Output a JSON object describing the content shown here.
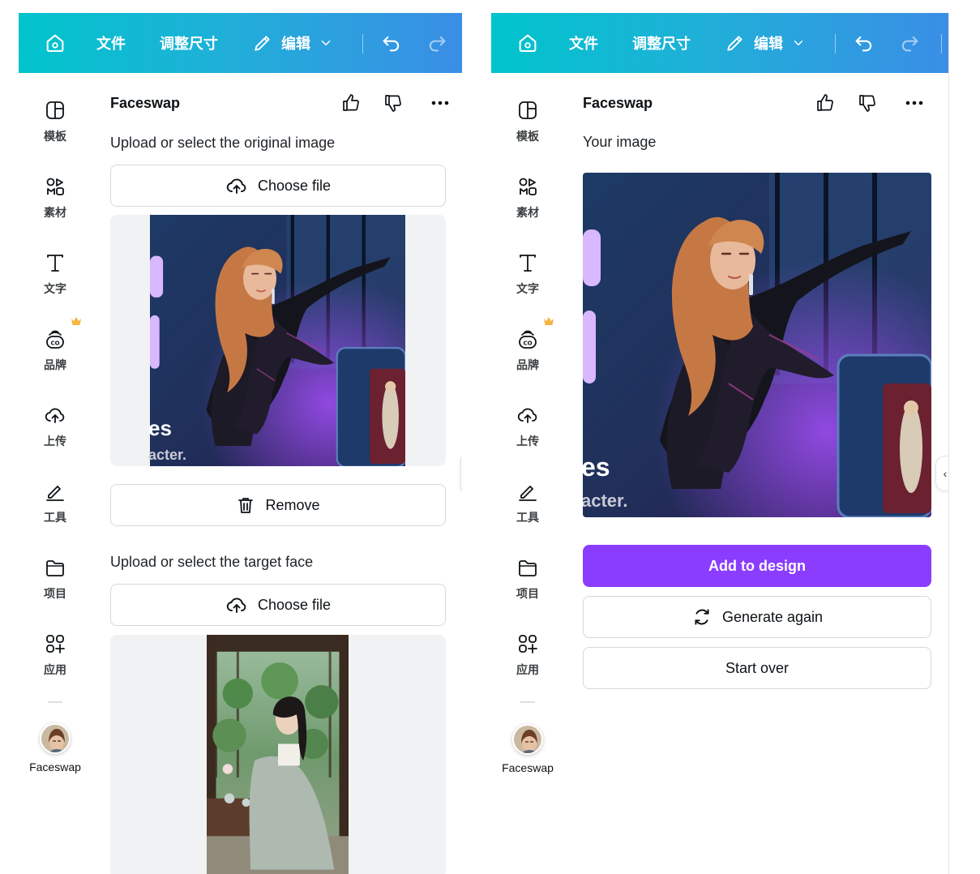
{
  "topbar": {
    "file": "文件",
    "resize": "调整尺寸",
    "edit": "编辑"
  },
  "sidebar": {
    "items": [
      {
        "label": "模板",
        "icon": "template-icon"
      },
      {
        "label": "素材",
        "icon": "elements-icon"
      },
      {
        "label": "文字",
        "icon": "text-icon"
      },
      {
        "label": "品牌",
        "icon": "brand-icon"
      },
      {
        "label": "上传",
        "icon": "upload-icon"
      },
      {
        "label": "工具",
        "icon": "tools-icon"
      },
      {
        "label": "项目",
        "icon": "projects-icon"
      },
      {
        "label": "应用",
        "icon": "apps-icon"
      }
    ],
    "active_app": "Faceswap"
  },
  "left_panel": {
    "title": "Faceswap",
    "original_label": "Upload or select the original image",
    "choose_file": "Choose file",
    "remove": "Remove",
    "target_label": "Upload or select the target face",
    "choose_file_2": "Choose file",
    "original_image_text": {
      "line1": "es",
      "line2": "acter."
    }
  },
  "right_panel": {
    "title": "Faceswap",
    "result_label": "Your image",
    "add_to_design": "Add to design",
    "generate_again": "Generate again",
    "start_over": "Start over",
    "result_image_text": {
      "line1": "es",
      "line2": "acter."
    }
  },
  "colors": {
    "accent": "#8b3dff",
    "topbar_start": "#00c4cc",
    "topbar_end": "#3a8ee6",
    "crown": "#f5b544"
  }
}
